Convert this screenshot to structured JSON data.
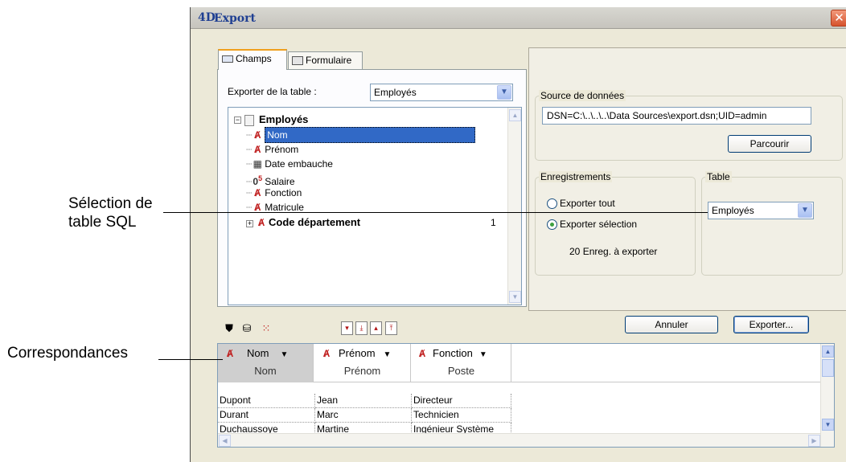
{
  "callouts": {
    "table_sql_line1": "Sélection de",
    "table_sql_line2": "table SQL",
    "correspondances": "Correspondances"
  },
  "window": {
    "logo": "4D",
    "title": "Export",
    "close_label": "✕"
  },
  "tabs": [
    {
      "label": "Champs",
      "active": true
    },
    {
      "label": "Formulaire",
      "active": false
    }
  ],
  "export_table": {
    "label": "Exporter de la table :",
    "value": "Employés"
  },
  "tree": {
    "root": "Employés",
    "fields": [
      "Nom",
      "Prénom",
      "Date embauche",
      "Salaire",
      "Fonction",
      "Matricule"
    ],
    "related": {
      "label": "Code département",
      "count": "1"
    },
    "selected": "Nom"
  },
  "source": {
    "title": "Source de données",
    "dsn": "DSN=C:\\..\\..\\..\\Data Sources\\export.dsn;UID=admin",
    "browse_label": "Parcourir"
  },
  "records": {
    "title": "Enregistrements",
    "export_all": "Exporter tout",
    "export_selection": "Exporter sélection",
    "count": "20",
    "count_label": "Enreg. à exporter",
    "selected_option": "export_selection"
  },
  "table_group": {
    "title": "Table",
    "value": "Employés"
  },
  "buttons": {
    "cancel": "Annuler",
    "export": "Exporter..."
  },
  "mapping": {
    "columns": [
      {
        "field": "Nom",
        "sql": "Nom"
      },
      {
        "field": "Prénom",
        "sql": "Prénom"
      },
      {
        "field": "Fonction",
        "sql": "Poste"
      }
    ],
    "rows": [
      [
        "Dupont",
        "Jean",
        "Directeur"
      ],
      [
        "Durant",
        "Marc",
        "Technicien"
      ],
      [
        "Duchaussoye",
        "Martine",
        "Ingénieur Système"
      ]
    ]
  },
  "colors": {
    "title_text": "#1f3f92",
    "selection": "#3169c6",
    "field_icon": "#c02020",
    "close": "#d6522d"
  }
}
